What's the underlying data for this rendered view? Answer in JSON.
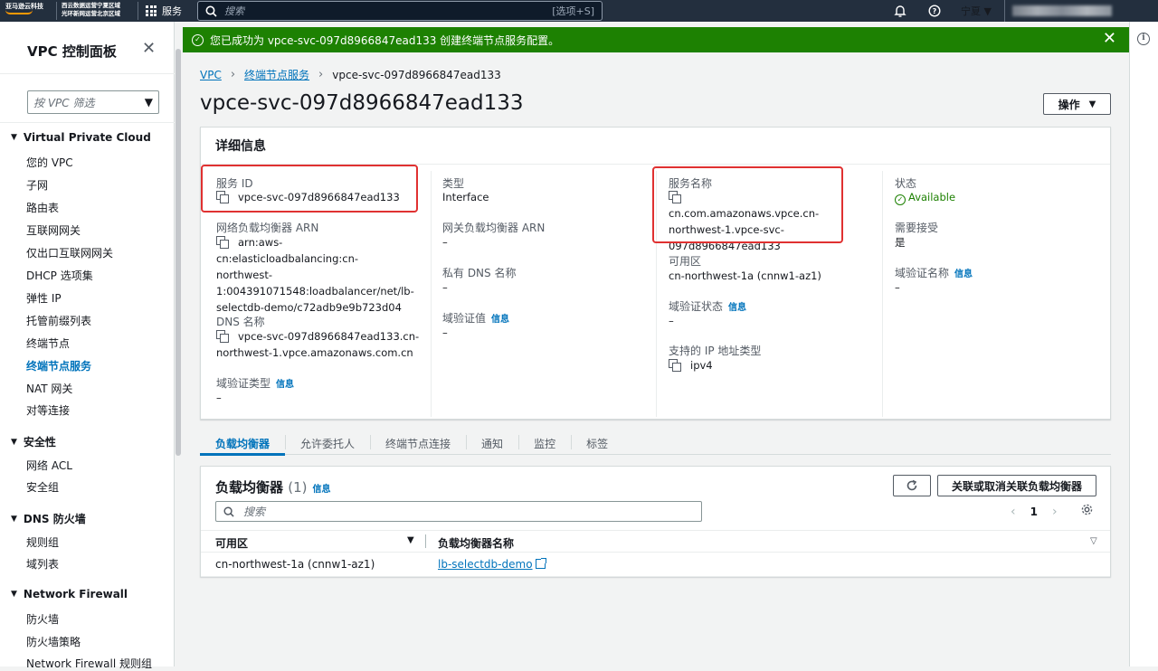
{
  "topnav": {
    "logo_text": "亚马逊云科技",
    "region_info_line1": "西云数据运营宁夏区域",
    "region_info_line2": "光环新网运营北京区域",
    "services_label": "服务",
    "search_placeholder": "搜索",
    "search_shortcut": "[选项+S]",
    "region": "宁夏"
  },
  "sidebar": {
    "title": "VPC 控制面板",
    "filter_placeholder": "按 VPC 筛选",
    "sections": [
      {
        "title": "Virtual Private Cloud",
        "items": [
          "您的 VPC",
          "子网",
          "路由表",
          "互联网网关",
          "仅出口互联网网关",
          "DHCP 选项集",
          "弹性 IP",
          "托管前缀列表",
          "终端节点",
          "终端节点服务",
          "NAT 网关",
          "对等连接"
        ]
      },
      {
        "title": "安全性",
        "items": [
          "网络 ACL",
          "安全组"
        ]
      },
      {
        "title": "DNS 防火墙",
        "items": [
          "规则组",
          "域列表"
        ]
      },
      {
        "title": "Network Firewall",
        "items": [
          "防火墙",
          "防火墙策略",
          "Network Firewall 规则组"
        ]
      }
    ],
    "active_item": "终端节点服务"
  },
  "flash": {
    "message": "您已成功为 vpce-svc-097d8966847ead133 创建终端节点服务配置。",
    "color": "#1d8102"
  },
  "breadcrumb": {
    "items": [
      "VPC",
      "终端节点服务",
      "vpce-svc-097d8966847ead133"
    ]
  },
  "page": {
    "title": "vpce-svc-097d8966847ead133",
    "actions_label": "操作"
  },
  "details": {
    "heading": "详细信息",
    "info_label": "信息",
    "col1": {
      "service_id_label": "服务 ID",
      "service_id": "vpce-svc-097d8966847ead133",
      "nlb_arn_label": "网络负载均衡器 ARN",
      "nlb_arn_lines": [
        "arn:aws-cn:elasticloadbalancing:cn-",
        "northwest-",
        "1:004391071548:loadbalancer/net/lb-",
        "selectdb-demo/c72adb9e9b723d04"
      ],
      "dns_label": "DNS 名称",
      "dns_lines": [
        "vpce-svc-097d8966847ead133.cn-",
        "northwest-1.vpce.amazonaws.com.cn"
      ],
      "domain_verif_type_label": "域验证类型",
      "domain_verif_type": "–"
    },
    "col2": {
      "type_label": "类型",
      "type": "Interface",
      "gwlb_arn_label": "网关负载均衡器 ARN",
      "gwlb_arn": "–",
      "private_dns_label": "私有 DNS 名称",
      "private_dns": "–",
      "domain_verif_value_label": "域验证值",
      "domain_verif_value": "–"
    },
    "col3": {
      "service_name_label": "服务名称",
      "service_name_lines": [
        "cn.com.amazonaws.vpce.cn-",
        "northwest-1.vpce-svc-",
        "097d8966847ead133"
      ],
      "az_label": "可用区",
      "az": "cn-northwest-1a (cnnw1-az1)",
      "domain_verif_status_label": "域验证状态",
      "domain_verif_status": "–",
      "ip_types_label": "支持的 IP 地址类型",
      "ip_types": "ipv4"
    },
    "col4": {
      "state_label": "状态",
      "state": "Available",
      "accept_required_label": "需要接受",
      "accept_required": "是",
      "domain_verif_name_label": "域验证名称",
      "domain_verif_name": "–"
    }
  },
  "tabs": [
    "负载均衡器",
    "允许委托人",
    "终端节点连接",
    "通知",
    "监控",
    "标签"
  ],
  "lb": {
    "title": "负载均衡器",
    "count": "(1)",
    "info": "信息",
    "assoc_button": "关联或取消关联负载均衡器",
    "search_placeholder": "搜索",
    "page": "1",
    "columns": [
      "可用区",
      "负载均衡器名称"
    ],
    "rows": [
      {
        "az": "cn-northwest-1a (cnnw1-az1)",
        "name": "lb-selectdb-demo"
      }
    ]
  }
}
